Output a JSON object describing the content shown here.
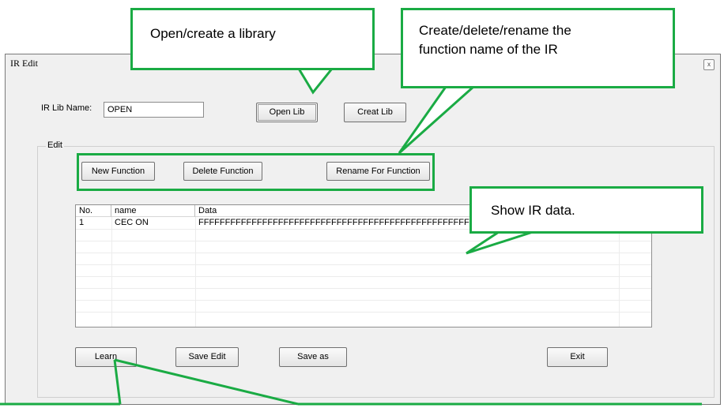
{
  "window": {
    "title": "IR Edit",
    "close_glyph": "x"
  },
  "library": {
    "name_label": "IR Lib Name:",
    "name_value": "OPEN",
    "open_lib_label": "Open Lib",
    "creat_lib_label": "Creat Lib"
  },
  "edit": {
    "group_label": "Edit",
    "new_function_label": "New Function",
    "delete_function_label": "Delete Function",
    "rename_function_label": "Rename For Function"
  },
  "table": {
    "columns": [
      "No.",
      "name",
      "Data"
    ],
    "rows": [
      {
        "no": "1",
        "name": "CEC ON",
        "data": "FFFFFFFFFFFFFFFFFFFFFFFFFFFFFFFFFFFFFFFFFFFFFFFFFFFFFFFFFFFFFFFFF"
      }
    ]
  },
  "footer": {
    "learn_label": "Learn",
    "save_edit_label": "Save Edit",
    "save_as_label": "Save as",
    "exit_label": "Exit"
  },
  "callouts": {
    "open_create": "Open/create a library",
    "function_name_line1": "Create/delete/rename the",
    "function_name_line2": "function name of the IR",
    "show_ir": "Show IR data."
  },
  "colors": {
    "callout_green": "#1aab44",
    "window_bg": "#f0f0f0"
  }
}
